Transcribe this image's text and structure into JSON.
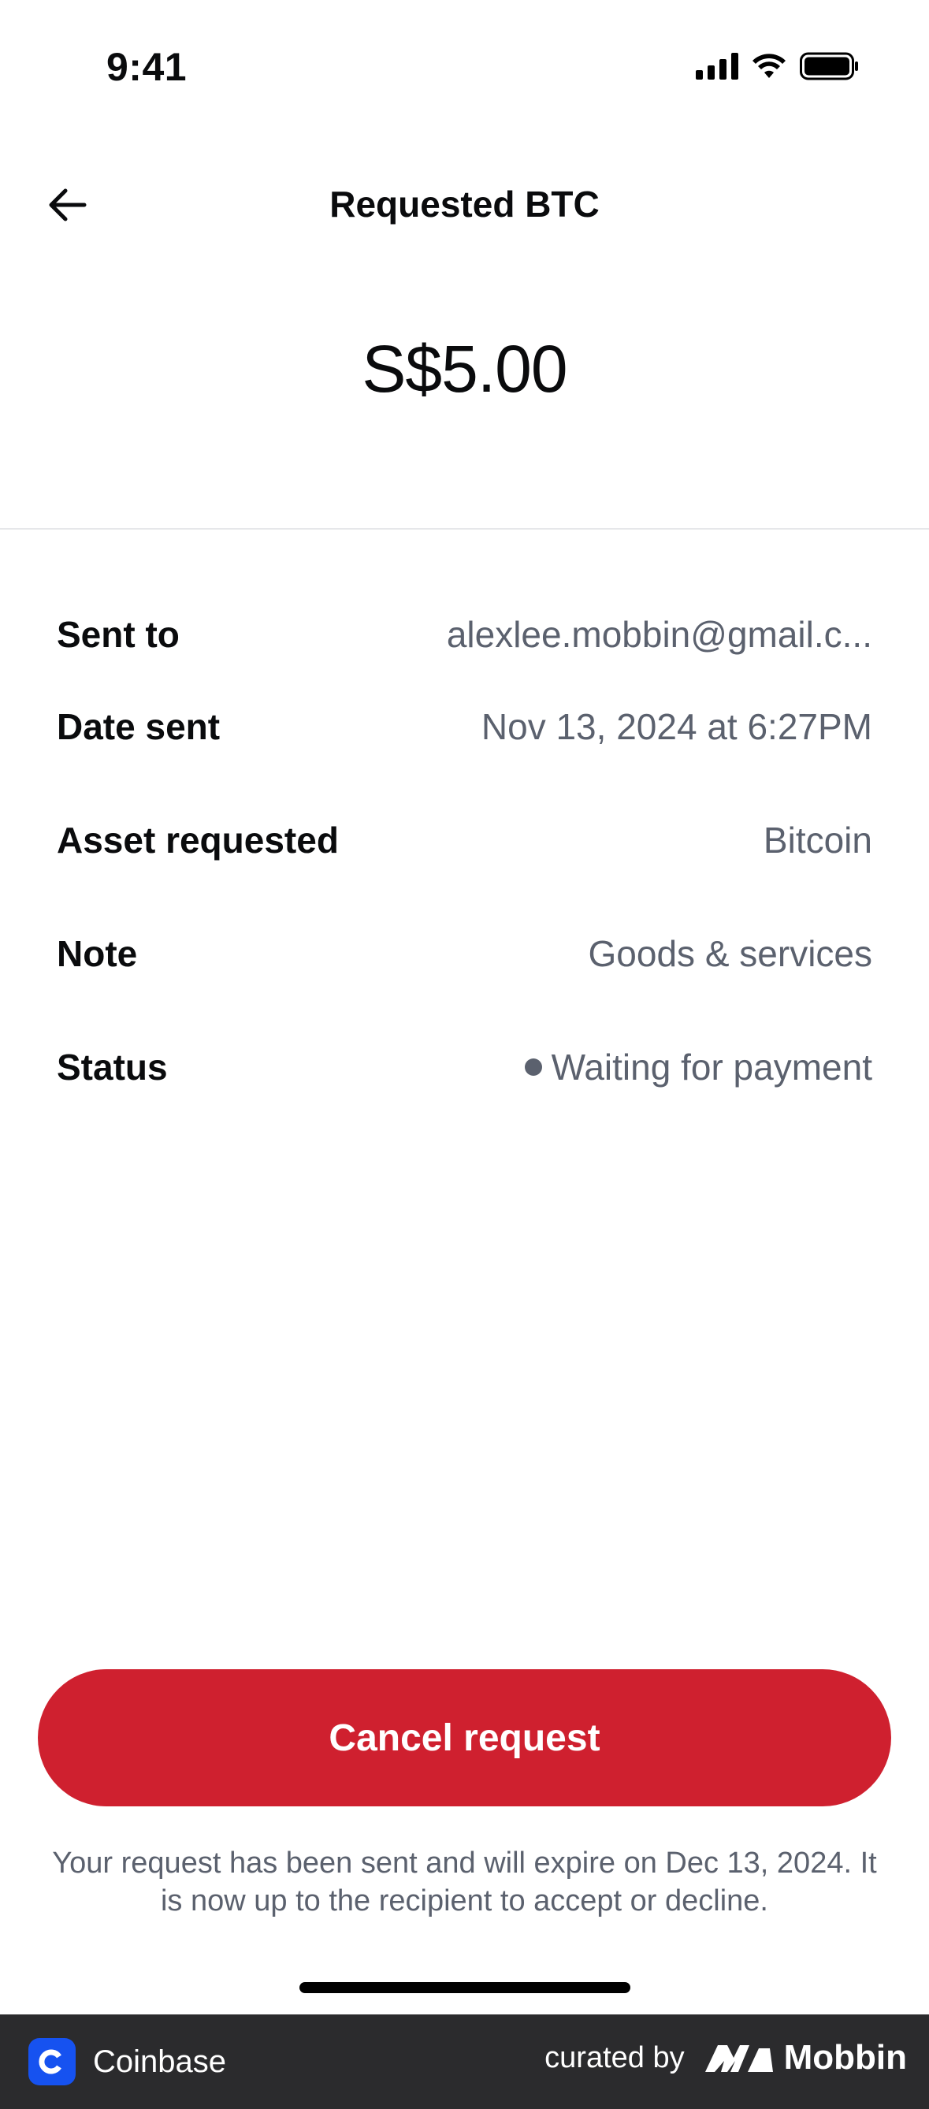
{
  "status_bar": {
    "time": "9:41"
  },
  "header": {
    "title": "Requested BTC"
  },
  "amount": "S$5.00",
  "details": [
    {
      "label": "Sent to",
      "value": "alexlee.mobbin@gmail.c..."
    },
    {
      "label": "Date sent",
      "value": "Nov 13, 2024 at 6:27PM"
    },
    {
      "label": "Asset requested",
      "value": "Bitcoin"
    },
    {
      "label": "Note",
      "value": "Goods & services"
    },
    {
      "label": "Status",
      "value": "Waiting for payment"
    }
  ],
  "cancel_button": {
    "label": "Cancel request",
    "color": "#cf202f"
  },
  "footnote": "Your request has been sent and will expire on Dec 13, 2024. It is now up to the recipient to accept or decline.",
  "brand_bar": {
    "app_name": "Coinbase",
    "curated_by": "curated by",
    "curator": "Mobbin"
  }
}
